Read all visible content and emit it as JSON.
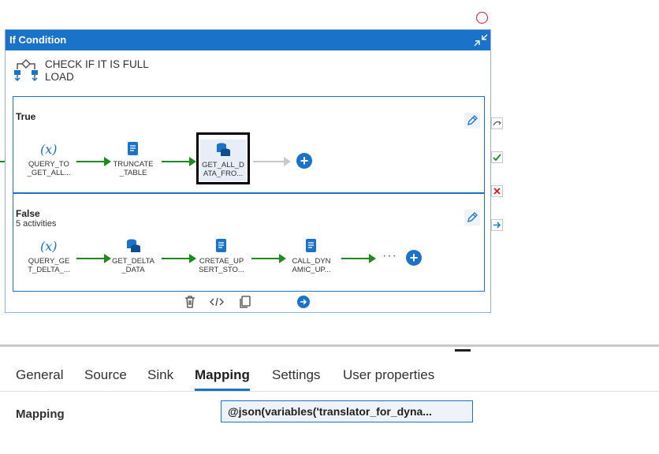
{
  "container": {
    "title": "If Condition",
    "activity_name_line1": "CHECK IF IT IS FULL",
    "activity_name_line2": "LOAD"
  },
  "true_branch": {
    "label": "True",
    "activities": [
      {
        "line1": "QUERY_TO",
        "line2": "_GET_ALL...",
        "icon": "variable-icon"
      },
      {
        "line1": "TRUNCATE",
        "line2": "_TABLE",
        "icon": "script-icon"
      },
      {
        "line1": "GET_ALL_D",
        "line2": "ATA_FRO...",
        "icon": "copy-data-icon"
      }
    ]
  },
  "false_branch": {
    "label": "False",
    "sublabel": "5 activities",
    "activities": [
      {
        "line1": "QUERY_GE",
        "line2": "T_DELTA_...",
        "icon": "variable-icon"
      },
      {
        "line1": "GET_DELTA",
        "line2": "_DATA",
        "icon": "copy-data-icon"
      },
      {
        "line1": "CRETAE_UP",
        "line2": "SERT_STO...",
        "icon": "script-icon"
      },
      {
        "line1": "CALL_DYN",
        "line2": "AMIC_UP...",
        "icon": "script-icon"
      }
    ],
    "more": "···"
  },
  "tabs": [
    {
      "label": "General"
    },
    {
      "label": "Source"
    },
    {
      "label": "Sink"
    },
    {
      "label": "Mapping",
      "active": true
    },
    {
      "label": "Settings"
    },
    {
      "label": "User properties"
    }
  ],
  "mapping": {
    "label": "Mapping",
    "value": "@json(variables('translator_for_dyna..."
  },
  "colors": {
    "accent": "#1a73c8",
    "success": "#1f8a1f",
    "failure": "#e81123"
  }
}
